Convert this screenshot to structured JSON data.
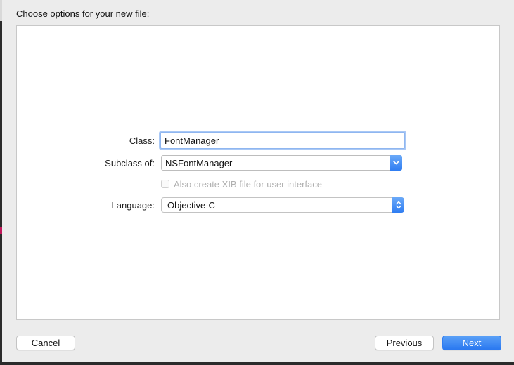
{
  "sheet": {
    "title": "Choose options for your new file:"
  },
  "form": {
    "class_label": "Class:",
    "class_value": "FontManager",
    "subclass_label": "Subclass of:",
    "subclass_value": "NSFontManager",
    "xib_checkbox_label": "Also create XIB file for user interface",
    "xib_checked": false,
    "xib_enabled": false,
    "language_label": "Language:",
    "language_value": "Objective-C"
  },
  "buttons": {
    "cancel": "Cancel",
    "previous": "Previous",
    "next": "Next"
  },
  "colors": {
    "accent": "#2f7df2",
    "focus_ring": "#a9c8f5",
    "disabled_text": "#b0b0b0"
  }
}
